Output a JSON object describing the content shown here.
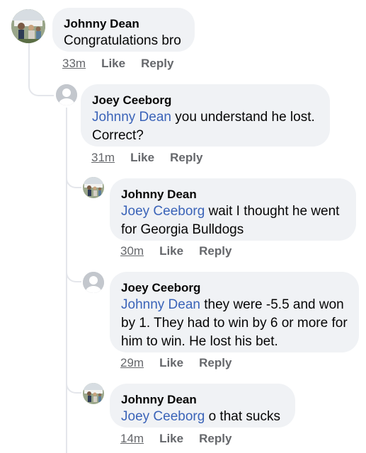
{
  "comments": [
    {
      "author": "Johnny Dean",
      "mention": "",
      "text": "Congratulations bro",
      "time": "33m",
      "like": "Like",
      "reply": "Reply"
    },
    {
      "author": "Joey Ceeborg",
      "mention": "Johnny Dean",
      "text": " you understand he lost. Correct?",
      "time": "31m",
      "like": "Like",
      "reply": "Reply"
    },
    {
      "author": "Johnny Dean",
      "mention": "Joey Ceeborg",
      "text": " wait I thought he went for Georgia Bulldogs",
      "time": "30m",
      "like": "Like",
      "reply": "Reply"
    },
    {
      "author": "Joey Ceeborg",
      "mention": "Johnny Dean",
      "text": " they were -5.5 and won by 1. They had to win by 6 or more for him to win. He lost his bet.",
      "time": "29m",
      "like": "Like",
      "reply": "Reply"
    },
    {
      "author": "Johnny Dean",
      "mention": "Joey Ceeborg",
      "text": " o that sucks",
      "time": "14m",
      "like": "Like",
      "reply": "Reply"
    }
  ],
  "colors": {
    "bubble": "#f0f2f5",
    "mention": "#3a63b8",
    "meta": "#65676b"
  }
}
